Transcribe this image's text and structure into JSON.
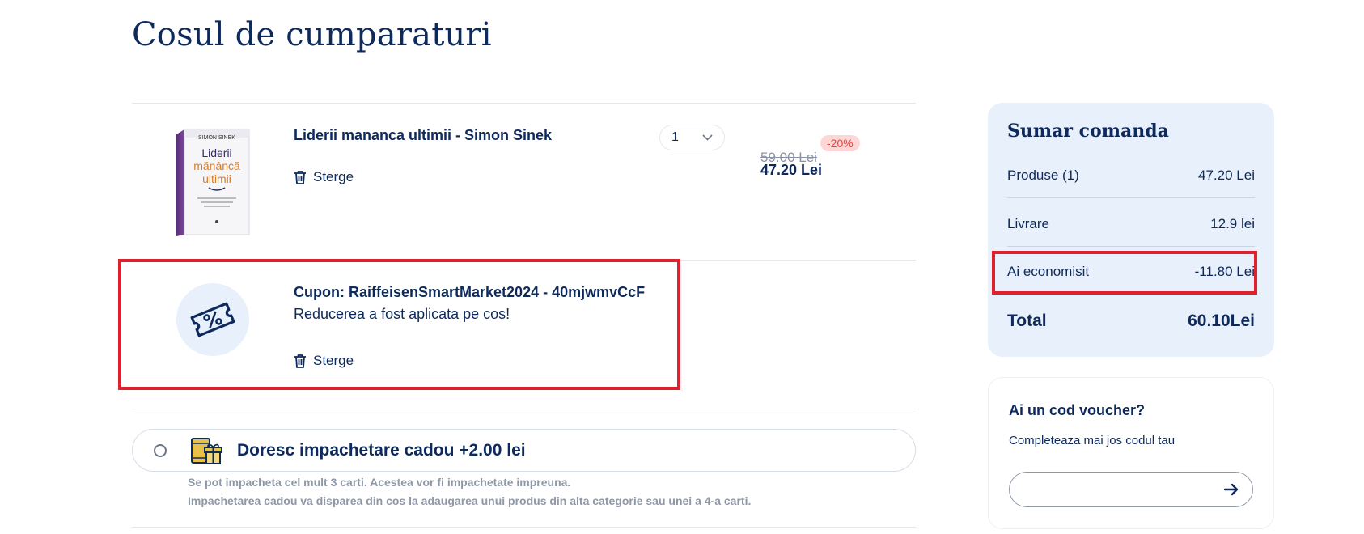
{
  "page": {
    "title": "Cosul de cumparaturi"
  },
  "cart": {
    "product": {
      "title": "Liderii mananca ultimii - Simon Sinek",
      "cover": {
        "author": "SIMON SINEK",
        "line1": "Liderii",
        "line2": "mănâncă",
        "line3": "ultimii"
      },
      "delete_label": "Sterge",
      "quantity": "1",
      "old_price": "59.00 Lei",
      "new_price": "47.20 Lei",
      "discount": "-20%"
    },
    "coupon": {
      "title": "Cupon: RaiffeisenSmartMarket2024 - 40mjwmvCcF",
      "message": "Reducerea a fost aplicata pe cos!",
      "delete_label": "Sterge"
    },
    "gift_wrap": {
      "label": "Doresc impachetare cadou +2.00 lei",
      "note1": "Se pot impacheta cel mult 3 carti. Acestea vor fi impachetate impreuna.",
      "note2": "Impachetarea cadou va disparea din cos la adaugarea unui produs din alta categorie sau unei a 4-a carti."
    }
  },
  "summary": {
    "title": "Sumar comanda",
    "rows": [
      {
        "label": "Produse (1)",
        "value": "47.20 Lei"
      },
      {
        "label": "Livrare",
        "value": "12.9 lei"
      },
      {
        "label": "Ai economisit",
        "value": "-11.80 Lei"
      }
    ],
    "total_label": "Total",
    "total_value": "60.10Lei"
  },
  "voucher": {
    "title": "Ai un cod voucher?",
    "subtitle": "Completeaza mai jos codul tau",
    "placeholder": ""
  },
  "colors": {
    "navy": "#0e2a5c",
    "highlight": "#e0202c",
    "summary_bg": "#e8f0fc",
    "discount_bg": "#ffd6d6"
  },
  "icons": [
    "trash-icon",
    "chevron-down-icon",
    "coupon-ticket-icon",
    "gift-wrap-icon",
    "arrow-right-icon"
  ]
}
